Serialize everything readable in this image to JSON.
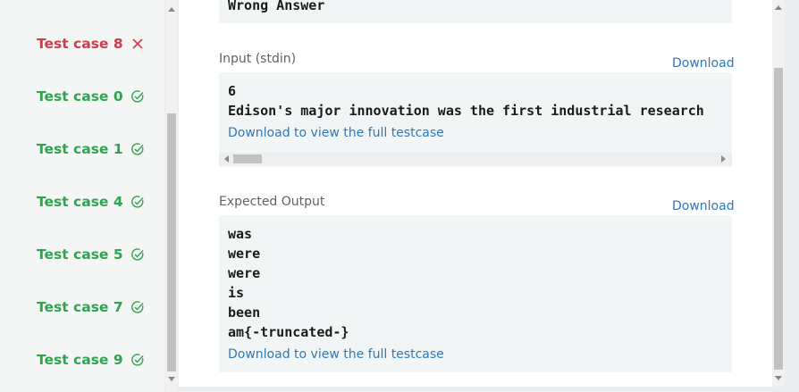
{
  "test_cases": [
    {
      "label": "Test case 8",
      "status": "fail",
      "icon": "x-icon"
    },
    {
      "label": "Test case 0",
      "status": "pass",
      "icon": "check-circle-icon"
    },
    {
      "label": "Test case 1",
      "status": "pass",
      "icon": "check-circle-icon"
    },
    {
      "label": "Test case 4",
      "status": "pass",
      "icon": "check-circle-icon"
    },
    {
      "label": "Test case 5",
      "status": "pass",
      "icon": "check-circle-icon"
    },
    {
      "label": "Test case 7",
      "status": "pass",
      "icon": "check-circle-icon"
    },
    {
      "label": "Test case 9",
      "status": "pass",
      "icon": "check-circle-icon"
    }
  ],
  "colors": {
    "pass": "#2ea44f",
    "fail": "#d33a4b",
    "link": "#3277b5"
  },
  "result": {
    "text": "Wrong Answer"
  },
  "input": {
    "label": "Input (stdin)",
    "download": "Download",
    "lines": [
      "6",
      "Edison's major innovation was the first industrial research"
    ],
    "full_link": "Download to view the full testcase"
  },
  "expected": {
    "label": "Expected Output",
    "download": "Download",
    "lines": [
      "was",
      "were",
      "were",
      "is",
      "been",
      "am{-truncated-}"
    ],
    "full_link": "Download to view the full testcase"
  }
}
